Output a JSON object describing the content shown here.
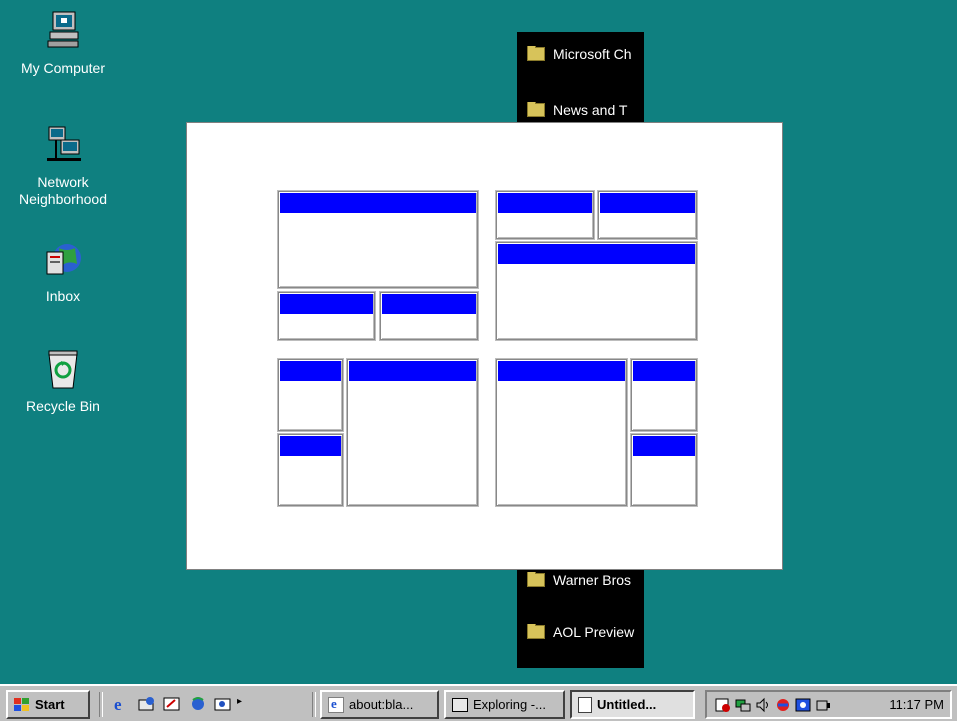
{
  "desktop": {
    "icons": [
      {
        "label": "My Computer",
        "icon": "my-computer-icon"
      },
      {
        "label": "Network\nNeighborhood",
        "icon": "network-neighborhood-icon"
      },
      {
        "label": "Inbox",
        "icon": "inbox-icon"
      },
      {
        "label": "Recycle Bin",
        "icon": "recycle-bin-icon"
      }
    ],
    "channel_bar": {
      "items": [
        "Microsoft Ch",
        "News and T",
        "Warner Bros",
        "AOL Preview"
      ]
    }
  },
  "taskbar": {
    "start_label": "Start",
    "windows": [
      "about:bla...",
      "Exploring -...",
      "Untitled..."
    ],
    "active_window": "Untitled...",
    "clock": "11:17 PM"
  },
  "colors": {
    "desktop": "#0f8080",
    "titlebar": "#0000ff",
    "taskbar": "#c0c0c0"
  }
}
